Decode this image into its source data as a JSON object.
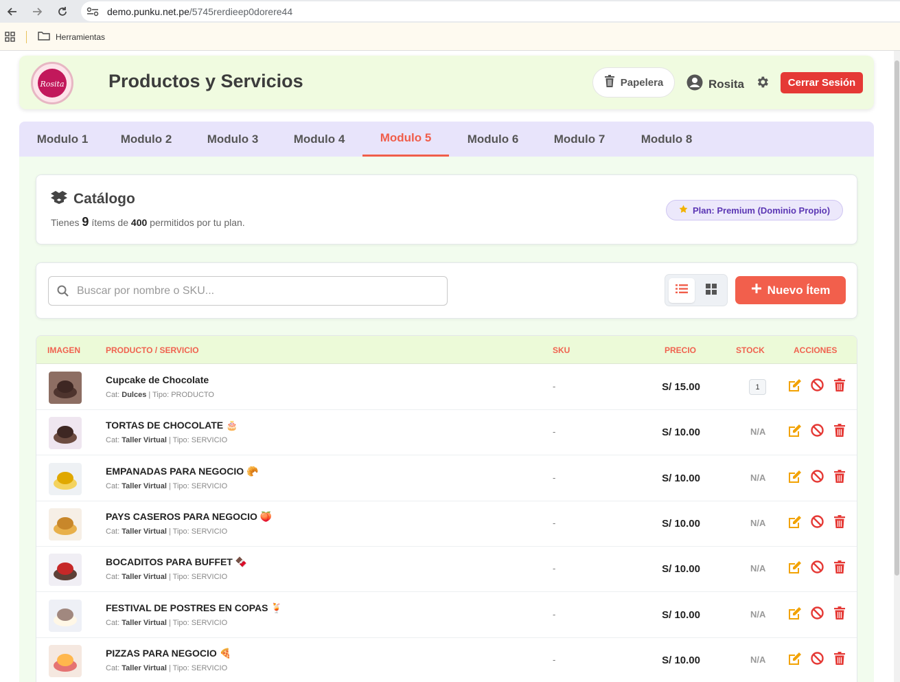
{
  "browser": {
    "url_domain": "demo.punku.net.pe",
    "url_path": "/5745rerdieep0dorere44",
    "bookmark_folder": "Herramientas"
  },
  "header": {
    "title": "Productos y Servicios",
    "trash_label": "Papelera",
    "user_name": "Rosita",
    "logout_label": "Cerrar Sesión",
    "logo_text": "Rosita"
  },
  "tabs": [
    {
      "label": "Modulo 1",
      "active": false
    },
    {
      "label": "Modulo 2",
      "active": false
    },
    {
      "label": "Modulo 3",
      "active": false
    },
    {
      "label": "Modulo 4",
      "active": false
    },
    {
      "label": "Modulo 5",
      "active": true
    },
    {
      "label": "Modulo 6",
      "active": false
    },
    {
      "label": "Modulo 7",
      "active": false
    },
    {
      "label": "Modulo 8",
      "active": false
    }
  ],
  "catalog": {
    "title": "Catálogo",
    "sub_prefix": "Tienes",
    "items_count": "9",
    "sub_mid": "ítems de",
    "items_limit": "400",
    "sub_suffix": "permitidos por tu plan.",
    "plan_label": "Plan: Premium (Dominio Propio)"
  },
  "search": {
    "placeholder": "Buscar por nombre o SKU...",
    "value": ""
  },
  "new_item_label": "Nuevo Ítem",
  "table": {
    "headers": {
      "image": "IMAGEN",
      "product": "PRODUCTO / SERVICIO",
      "sku": "SKU",
      "price": "PRECIO",
      "stock": "STOCK",
      "actions": "ACCIONES"
    },
    "cat_label": "Cat:",
    "type_label": "| Tipo:",
    "rows": [
      {
        "name": "Cupcake de Chocolate",
        "emoji": "",
        "category": "Dulces",
        "type": "PRODUCTO",
        "sku": "-",
        "price": "S/ 15.00",
        "stock": "1",
        "stock_badge": true
      },
      {
        "name": "TORTAS DE CHOCOLATE",
        "emoji": "🎂",
        "category": "Taller Virtual",
        "type": "SERVICIO",
        "sku": "-",
        "price": "S/ 10.00",
        "stock": "N/A",
        "stock_badge": false
      },
      {
        "name": "EMPANADAS PARA NEGOCIO",
        "emoji": "🥐",
        "category": "Taller Virtual",
        "type": "SERVICIO",
        "sku": "-",
        "price": "S/ 10.00",
        "stock": "N/A",
        "stock_badge": false
      },
      {
        "name": "PAYS CASEROS PARA NEGOCIO",
        "emoji": "🍑",
        "category": "Taller Virtual",
        "type": "SERVICIO",
        "sku": "-",
        "price": "S/ 10.00",
        "stock": "N/A",
        "stock_badge": false
      },
      {
        "name": "BOCADITOS PARA BUFFET",
        "emoji": "🍫",
        "category": "Taller Virtual",
        "type": "SERVICIO",
        "sku": "-",
        "price": "S/ 10.00",
        "stock": "N/A",
        "stock_badge": false
      },
      {
        "name": "FESTIVAL DE POSTRES EN COPAS",
        "emoji": "🍹",
        "category": "Taller Virtual",
        "type": "SERVICIO",
        "sku": "-",
        "price": "S/ 10.00",
        "stock": "N/A",
        "stock_badge": false
      },
      {
        "name": "PIZZAS PARA NEGOCIO",
        "emoji": "🍕",
        "category": "Taller Virtual",
        "type": "SERVICIO",
        "sku": "-",
        "price": "S/ 10.00",
        "stock": "N/A",
        "stock_badge": false
      }
    ]
  },
  "colors": {
    "accent": "#f05d4a",
    "logout": "#e53935",
    "edit": "#f2a200",
    "disable": "#e53935",
    "delete": "#e53935",
    "plan_text": "#5b36b4"
  },
  "icons": [
    "back-arrow-icon",
    "forward-arrow-icon",
    "reload-icon",
    "site-settings-icon",
    "apps-grid-icon",
    "folder-icon",
    "trash-icon",
    "user-circle-icon",
    "gear-icon",
    "box-open-icon",
    "star-icon",
    "search-icon",
    "list-view-icon",
    "grid-view-icon",
    "plus-icon",
    "edit-icon",
    "ban-icon",
    "delete-icon"
  ]
}
